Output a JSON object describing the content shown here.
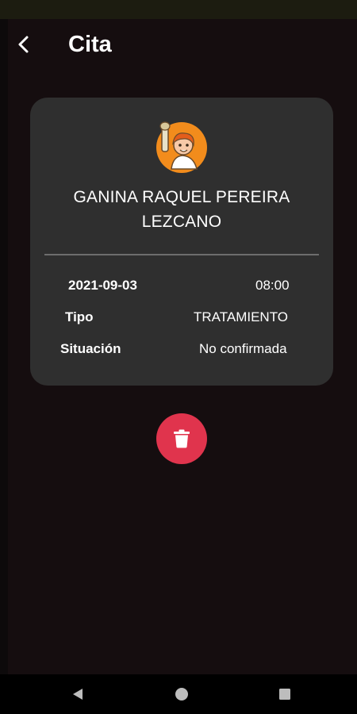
{
  "header": {
    "title": "Cita",
    "back_icon": "chevron-left-icon"
  },
  "appointment": {
    "patient_name_line1": "GANINA RAQUEL PEREIRA",
    "patient_name_line2": "LEZCANO",
    "date": "2021-09-03",
    "time": "08:00",
    "type_label": "Tipo",
    "type_value": "TRATAMIENTO",
    "status_label": "Situación",
    "status_value": "No confirmada"
  },
  "actions": {
    "delete_icon": "trash-icon",
    "delete_color": "#e0344d"
  },
  "system_nav": {
    "back_icon": "nav-back-icon",
    "home_icon": "nav-home-icon",
    "recents_icon": "nav-recents-icon"
  },
  "colors": {
    "background": "#150d0f",
    "card": "#2f2f2f",
    "text": "#ffffff",
    "avatar_bg": "#f28c1c"
  }
}
